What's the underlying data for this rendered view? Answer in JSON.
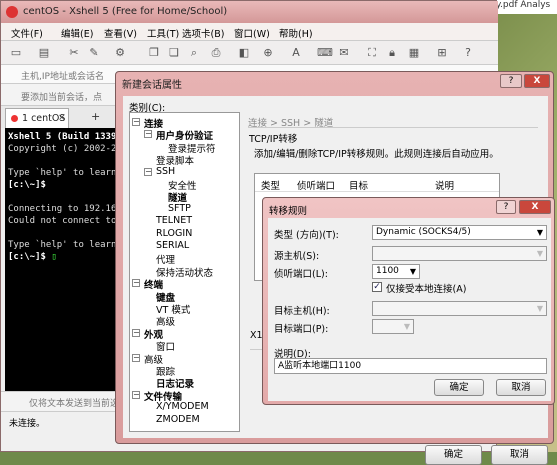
{
  "desktop": {
    "corner_text": "y.pdf   Analys"
  },
  "xshell": {
    "title": "centOS - Xshell 5 (Free for Home/School)",
    "menu": [
      "文件(F)",
      "编辑(E)",
      "查看(V)",
      "工具(T)",
      "选项卡(B)",
      "窗口(W)",
      "帮助(H)"
    ],
    "address_hint": "主机,IP地址或会话名",
    "add_hint": "要添加当前会话，点",
    "tab_label": "1 centOS",
    "tab_close": "×",
    "tab_add": "+",
    "terminal_lines": [
      "Xshell 5 (Build 1339",
      "Copyright (c) 2002-2",
      "",
      "Type `help' to learn",
      "[c:\\~]$",
      "",
      "Connecting to 192.16",
      "Could not connect to",
      "",
      "Type `help' to learn",
      "[c:\\~]$ "
    ],
    "send_hint": "仅将文本发送到当前选",
    "status": "未连接。"
  },
  "dialog": {
    "title": "新建会话属性",
    "help": "?",
    "close": "X",
    "category_label": "类别(C):",
    "tree": [
      {
        "label": "连接",
        "bold": true,
        "level": 0,
        "toggle": "−"
      },
      {
        "label": "用户身份验证",
        "bold": true,
        "level": 1,
        "toggle": "−"
      },
      {
        "label": "登录提示符",
        "bold": false,
        "level": 2,
        "toggle": ""
      },
      {
        "label": "登录脚本",
        "bold": false,
        "level": 1,
        "toggle": ""
      },
      {
        "label": "SSH",
        "bold": false,
        "level": 1,
        "toggle": "−"
      },
      {
        "label": "安全性",
        "bold": false,
        "level": 2,
        "toggle": ""
      },
      {
        "label": "隧道",
        "bold": true,
        "level": 2,
        "toggle": ""
      },
      {
        "label": "SFTP",
        "bold": false,
        "level": 2,
        "toggle": ""
      },
      {
        "label": "TELNET",
        "bold": false,
        "level": 1,
        "toggle": ""
      },
      {
        "label": "RLOGIN",
        "bold": false,
        "level": 1,
        "toggle": ""
      },
      {
        "label": "SERIAL",
        "bold": false,
        "level": 1,
        "toggle": ""
      },
      {
        "label": "代理",
        "bold": false,
        "level": 1,
        "toggle": ""
      },
      {
        "label": "保持活动状态",
        "bold": false,
        "level": 1,
        "toggle": ""
      },
      {
        "label": "终端",
        "bold": true,
        "level": 0,
        "toggle": "−"
      },
      {
        "label": "键盘",
        "bold": true,
        "level": 1,
        "toggle": ""
      },
      {
        "label": "VT 模式",
        "bold": false,
        "level": 1,
        "toggle": ""
      },
      {
        "label": "高级",
        "bold": false,
        "level": 1,
        "toggle": ""
      },
      {
        "label": "外观",
        "bold": true,
        "level": 0,
        "toggle": "−"
      },
      {
        "label": "窗口",
        "bold": false,
        "level": 1,
        "toggle": ""
      },
      {
        "label": "高级",
        "bold": false,
        "level": 0,
        "toggle": "−"
      },
      {
        "label": "跟踪",
        "bold": false,
        "level": 1,
        "toggle": ""
      },
      {
        "label": "日志记录",
        "bold": true,
        "level": 1,
        "toggle": ""
      },
      {
        "label": "文件传输",
        "bold": true,
        "level": 0,
        "toggle": "−"
      },
      {
        "label": "X/YMODEM",
        "bold": false,
        "level": 1,
        "toggle": ""
      },
      {
        "label": "ZMODEM",
        "bold": false,
        "level": 1,
        "toggle": ""
      }
    ],
    "breadcrumb": "连接 > SSH > 隧道",
    "section_title": "TCP/IP转移",
    "description": "添加/编辑/删除TCP/IP转移规则。此规则连接后自动应用。",
    "table_headers": [
      "类型",
      "侦听端口",
      "目标",
      "说明"
    ],
    "x11_label": "X1",
    "ok": "确定",
    "cancel": "取消"
  },
  "rule_dialog": {
    "title": "转移规则",
    "help": "?",
    "close": "X",
    "type_label": "类型 (方向)(T):",
    "type_value": "Dynamic (SOCKS4/5)",
    "source_host_label": "源主机(S):",
    "listen_port_label": "侦听端口(L):",
    "listen_port_value": "1100",
    "localhost_only_label": "仅接受本地连接(A)",
    "localhost_only_mark": "✓",
    "target_host_label": "目标主机(H):",
    "target_port_label": "目标端口(P):",
    "note_label": "说明(D):",
    "note_value": "A监听本地端口1100",
    "ok": "确定",
    "cancel": "取消"
  }
}
